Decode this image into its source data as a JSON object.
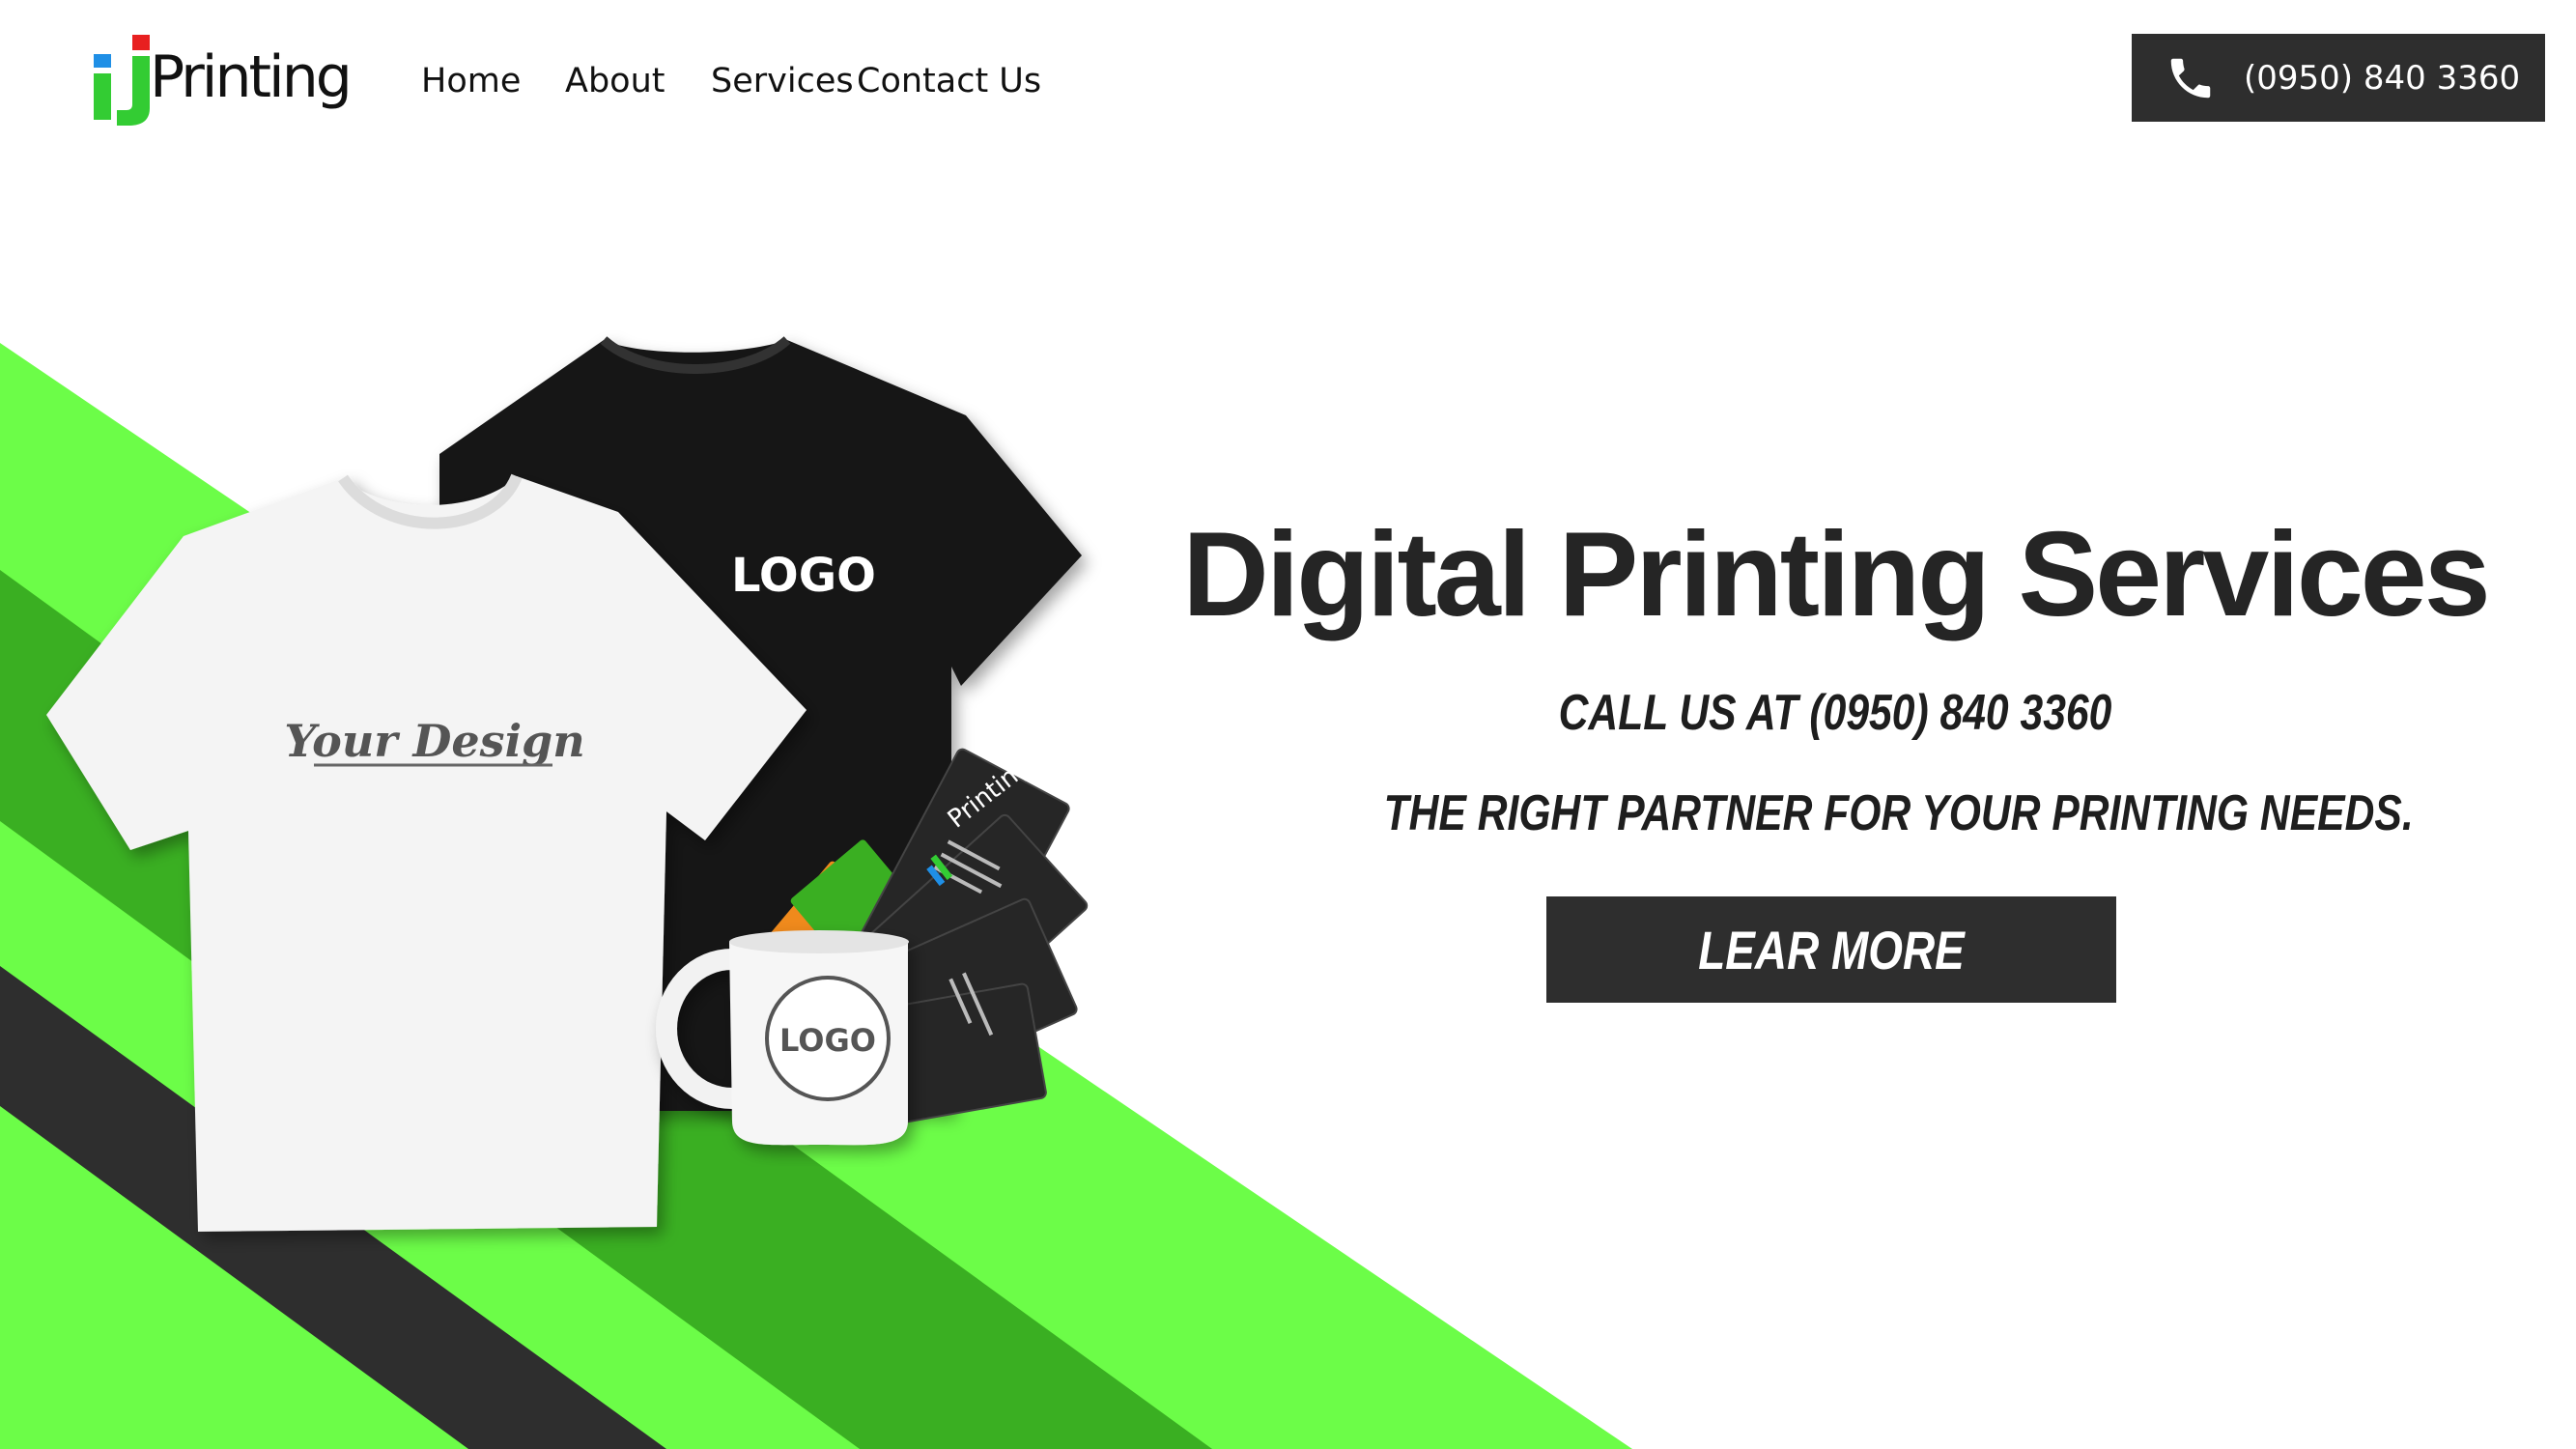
{
  "brand": {
    "logo_letters": "iJ",
    "logo_word": "Printing"
  },
  "nav": {
    "items": [
      {
        "label": "Home"
      },
      {
        "label": "About"
      },
      {
        "label": "Services"
      },
      {
        "label": "Contact Us"
      }
    ]
  },
  "header": {
    "phone_icon": "phone-icon",
    "phone_number": "(0950) 840 3360"
  },
  "hero": {
    "title": "Digital Printing Services",
    "call_line": "CALL US AT (0950) 840 3360",
    "tagline": "THE RIGHT PARTNER  FOR YOUR PRINTING NEEDS.",
    "cta_label": "LEAR MORE"
  },
  "mockups": {
    "white_shirt_text": "Your Design",
    "black_shirt_text": "LOGO",
    "mug_text": "LOGO",
    "card_brand": "Printing"
  },
  "colors": {
    "bright_green": "#6cfd48",
    "dark_green": "#3aaf22",
    "charcoal": "#2e2e2e",
    "logo_blue": "#1f8fe6",
    "logo_green": "#33cc33",
    "logo_red": "#e82020"
  }
}
